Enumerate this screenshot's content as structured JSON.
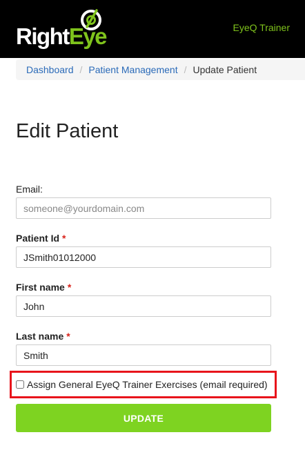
{
  "header": {
    "logo_part1": "Right",
    "logo_part2": "Eye",
    "app_link": "EyeQ Trainer",
    "brand_color": "#7fc31c"
  },
  "breadcrumb": {
    "items": [
      "Dashboard",
      "Patient Management"
    ],
    "separator": "/",
    "current": "Update Patient"
  },
  "page": {
    "title": "Edit Patient"
  },
  "form": {
    "email": {
      "label": "Email:",
      "value": "",
      "placeholder": "someone@yourdomain.com"
    },
    "patient_id": {
      "label": "Patient Id",
      "required_mark": "*",
      "value": "JSmith01012000"
    },
    "first_name": {
      "label": "First name",
      "required_mark": "*",
      "value": "John"
    },
    "last_name": {
      "label": "Last name",
      "required_mark": "*",
      "value": "Smith"
    },
    "assign_checkbox": {
      "label": "Assign General EyeQ Trainer Exercises (email required)",
      "checked": false
    },
    "submit_label": "UPDATE"
  }
}
